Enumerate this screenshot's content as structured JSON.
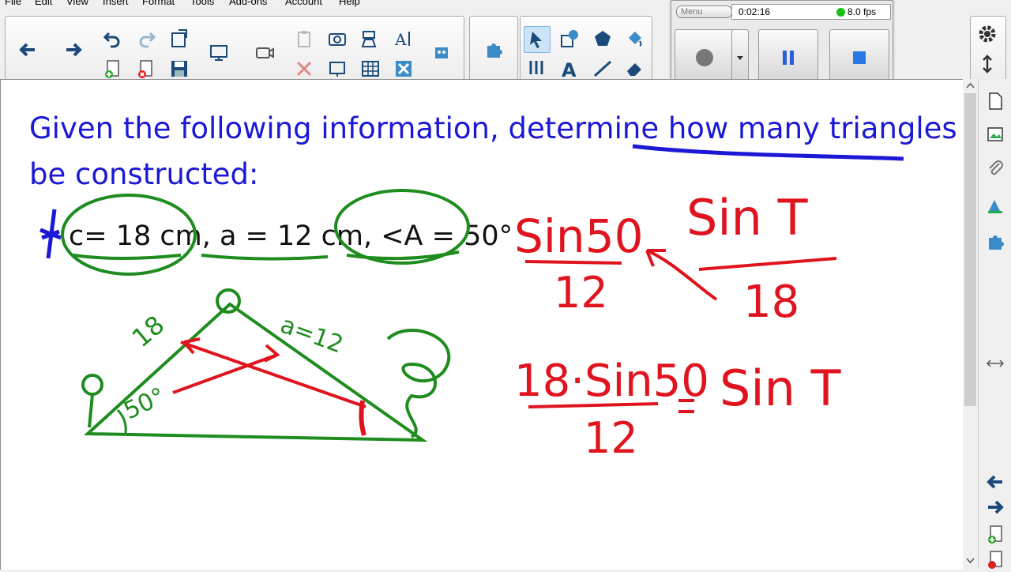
{
  "menu": {
    "file": "File",
    "edit": "Edit",
    "view": "View",
    "insert": "Insert",
    "format": "Format",
    "tools": "Tools",
    "addons": "Add-ons",
    "account": "Account",
    "help": "Help"
  },
  "recorder": {
    "menu_label": "Menu",
    "elapsed": "0:02:16",
    "fps": "8.0 fps",
    "status_color": "#19c219"
  },
  "page": {
    "question_line1": "Given the following information, determine how many triangles can",
    "question_line2": "be constructed:",
    "given": "c= 18 cm, a = 12 cm, <A = 50°"
  },
  "colors": {
    "question_text": "#1b18d6",
    "green_ink": "#1e8c1e",
    "red_ink": "#e0141e",
    "blue_ink": "#1b18d6"
  },
  "icons": [
    "back-arrow-icon",
    "forward-arrow-icon",
    "undo-icon",
    "redo-icon",
    "paste-icon",
    "add-page-icon",
    "delete-page-icon",
    "save-icon",
    "screen-shade-icon",
    "camera-icon",
    "clipboard-icon",
    "delete-icon",
    "screen-capture-icon",
    "table-icon",
    "clear-icon",
    "select-icon",
    "shapes-icon",
    "fill-icon",
    "pens-icon",
    "text-icon",
    "line-icon",
    "eraser-icon",
    "gear-icon",
    "move-toolbar-icon"
  ]
}
